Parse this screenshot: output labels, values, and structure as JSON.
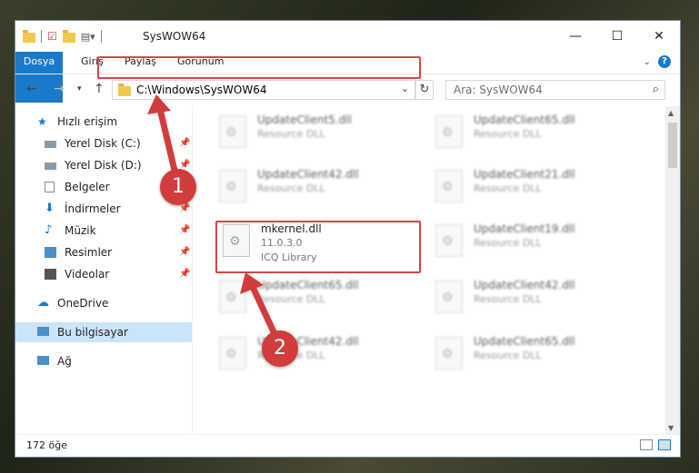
{
  "window": {
    "title": "SysWOW64"
  },
  "ribbon": {
    "tabs": [
      "Dosya",
      "Giriş",
      "Paylaş",
      "Görünüm"
    ],
    "help": "?"
  },
  "address": {
    "path": "C:\\Windows\\SysWOW64"
  },
  "search": {
    "placeholder": "Ara: SysWOW64"
  },
  "sidebar": {
    "items": [
      {
        "label": "Hızlı erişim",
        "icon": "star-icon"
      },
      {
        "label": "Yerel Disk (C:)",
        "icon": "drive-icon",
        "pinned": true
      },
      {
        "label": "Yerel Disk (D:)",
        "icon": "drive-icon",
        "pinned": true
      },
      {
        "label": "Belgeler",
        "icon": "document-icon",
        "pinned": true
      },
      {
        "label": "İndirmeler",
        "icon": "download-icon",
        "pinned": true
      },
      {
        "label": "Müzik",
        "icon": "music-icon",
        "pinned": true
      },
      {
        "label": "Resimler",
        "icon": "pictures-icon",
        "pinned": true
      },
      {
        "label": "Videolar",
        "icon": "video-icon",
        "pinned": true
      },
      {
        "label": "OneDrive",
        "icon": "cloud-icon"
      },
      {
        "label": "Bu bilgisayar",
        "icon": "computer-icon",
        "selected": true
      },
      {
        "label": "Ağ",
        "icon": "network-icon"
      }
    ]
  },
  "files": [
    {
      "name": "UpdateClient5.dll",
      "type": "Resource DLL"
    },
    {
      "name": "UpdateClient65.dll",
      "type": "Resource DLL"
    },
    {
      "name": "UpdateClient42.dll",
      "type": "Resource DLL"
    },
    {
      "name": "UpdateClient21.dll",
      "type": "Resource DLL"
    },
    {
      "name": "mkernel.dll",
      "version": "11.0.3.0",
      "type": "ICQ Library"
    },
    {
      "name": "UpdateClient19.dll",
      "type": "Resource DLL"
    },
    {
      "name": "UpdateClient65.dll",
      "type": "Resource DLL"
    },
    {
      "name": "UpdateClient42.dll",
      "type": "Resource DLL"
    },
    {
      "name": "UpdateClient42.dll",
      "type": "Resource DLL"
    },
    {
      "name": "UpdateClient65.dll",
      "type": "Resource DLL"
    }
  ],
  "status": {
    "count": "172 öğe"
  },
  "callouts": [
    "1",
    "2"
  ],
  "colors": {
    "accent": "#1979ca",
    "highlight": "#d64545"
  }
}
